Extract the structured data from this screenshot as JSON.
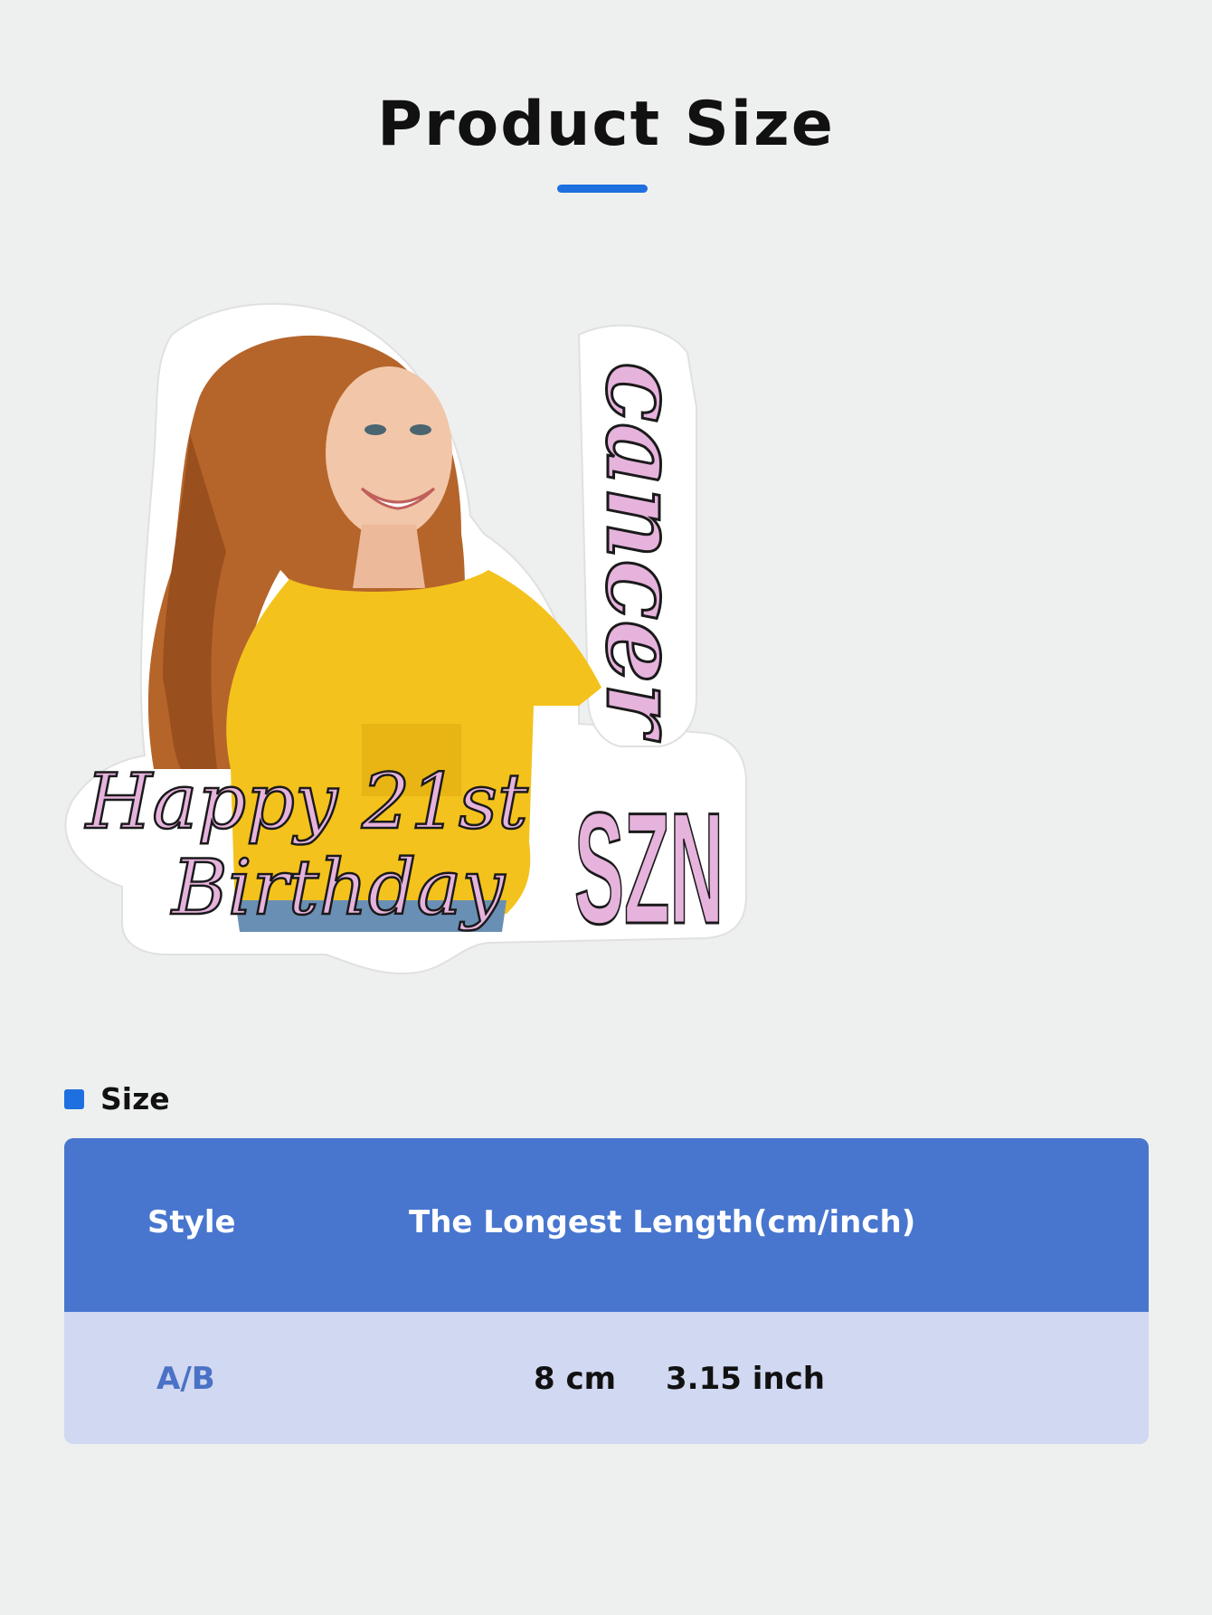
{
  "header": {
    "title": "Product Size"
  },
  "sticker": {
    "text_vertical": "cancer",
    "text_greeting_line1": "Happy 21st",
    "text_greeting_line2": "Birthday",
    "text_szn": "SZN",
    "colors": {
      "text_fill": "#e6b3dd",
      "text_outline": "#1a1a1a",
      "shirt": "#f4c21c",
      "hair": "#b5652a"
    }
  },
  "size_section": {
    "label": "Size",
    "table": {
      "headers": [
        "Style",
        "The Longest Length(cm/inch)"
      ],
      "rows": [
        {
          "style": "A/B",
          "cm": "8 cm",
          "inch": "3.15 inch"
        }
      ]
    }
  },
  "colors": {
    "accent": "#1e6fe0",
    "table_header": "#4876cf",
    "table_row": "#d1d8f1",
    "style_text": "#4a72c6"
  }
}
